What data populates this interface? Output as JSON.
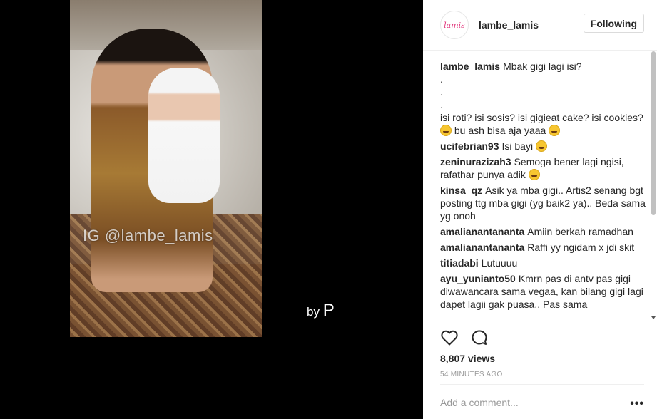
{
  "media": {
    "watermark": "IG @lambe_lamis",
    "byline": "by",
    "byline_mark": "P"
  },
  "header": {
    "username": "lambe_lamis",
    "follow_label": "Following"
  },
  "caption": {
    "user": "lambe_lamis",
    "text": "Mbak gigi lagi isi?",
    "dots": [
      ".",
      ".",
      "."
    ],
    "text2": "isi roti? isi sosis? isi gigieat cake? isi cookies?",
    "text3": "bu ash bisa aja yaaa"
  },
  "comments": [
    {
      "user": "ucifebrian93",
      "text": "Isi bayi",
      "emoji": true
    },
    {
      "user": "zeninurazizah3",
      "text": "Semoga bener lagi ngisi, rafathar punya adik",
      "emoji": true
    },
    {
      "user": "kinsa_qz",
      "text": "Asik ya mba gigi.. Artis2 senang bgt posting ttg mba gigi (yg baik2 ya).. Beda sama yg onoh",
      "emoji": false
    },
    {
      "user": "amalianantananta",
      "text": "Amiin berkah ramadhan",
      "emoji": false
    },
    {
      "user": "amalianantananta",
      "text": "Raffi yy ngidam x jdi skit",
      "emoji": false
    },
    {
      "user": "titiadabi",
      "text": "Lutuuuu",
      "emoji": false
    },
    {
      "user": "ayu_yunianto50",
      "text": "Kmrn pas di antv pas gigi diwawancara sama vegaa, kan bilang gigi lagi dapet lagii gak puasa.. Pas sama",
      "emoji": false
    }
  ],
  "actions": {
    "like_icon": "heart-icon",
    "comment_icon": "comment-bubble-icon",
    "views": "8,807 views",
    "time": "54 MINUTES AGO",
    "comment_placeholder": "Add a comment...",
    "more_label": "•••"
  }
}
